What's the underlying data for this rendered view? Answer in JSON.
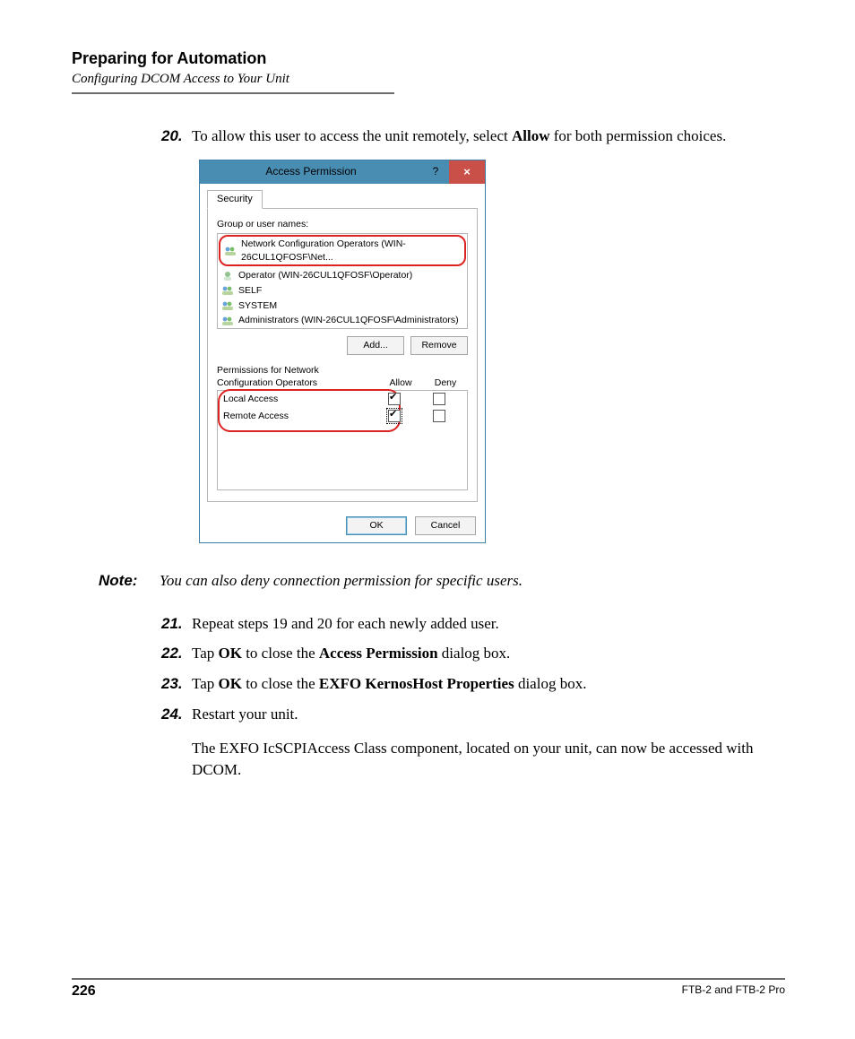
{
  "header": {
    "title": "Preparing for Automation",
    "subtitle": "Configuring DCOM Access to Your Unit"
  },
  "steps": {
    "s20_num": "20.",
    "s20_a": "To allow this user to access the unit remotely, select ",
    "s20_b": "Allow",
    "s20_c": " for both permission choices.",
    "s21_num": "21.",
    "s21": "Repeat steps 19 and 20 for each newly added user.",
    "s22_num": "22.",
    "s22_a": "Tap ",
    "s22_b": "OK",
    "s22_c": " to close the ",
    "s22_d": "Access Permission",
    "s22_e": " dialog box.",
    "s23_num": "23.",
    "s23_a": "Tap ",
    "s23_b": "OK",
    "s23_c": " to close the ",
    "s23_d": "EXFO KernosHost Properties",
    "s23_e": " dialog box.",
    "s24_num": "24.",
    "s24": "Restart your unit.",
    "closing": "The EXFO IcSCPIAccess Class component, located on your unit, can now be accessed with DCOM."
  },
  "note": {
    "label": "Note:",
    "text": "You can also deny connection permission for specific users."
  },
  "dialog": {
    "title": "Access Permission",
    "help": "?",
    "close": "×",
    "tab": "Security",
    "group_label": "Group or user names:",
    "users": {
      "u0": "Network Configuration Operators (WIN-26CUL1QFOSF\\Net...",
      "u1": "Operator (WIN-26CUL1QFOSF\\Operator)",
      "u2": "SELF",
      "u3": "SYSTEM",
      "u4": "Administrators (WIN-26CUL1QFOSF\\Administrators)"
    },
    "add_btn": "Add...",
    "remove_btn": "Remove",
    "perm_label_a": "Permissions for Network",
    "perm_label_b": "Configuration Operators",
    "col_allow": "Allow",
    "col_deny": "Deny",
    "perm1": "Local Access",
    "perm2": "Remote Access",
    "ok_btn": "OK",
    "cancel_btn": "Cancel"
  },
  "footer": {
    "page": "226",
    "product": "FTB-2 and FTB-2 Pro"
  }
}
